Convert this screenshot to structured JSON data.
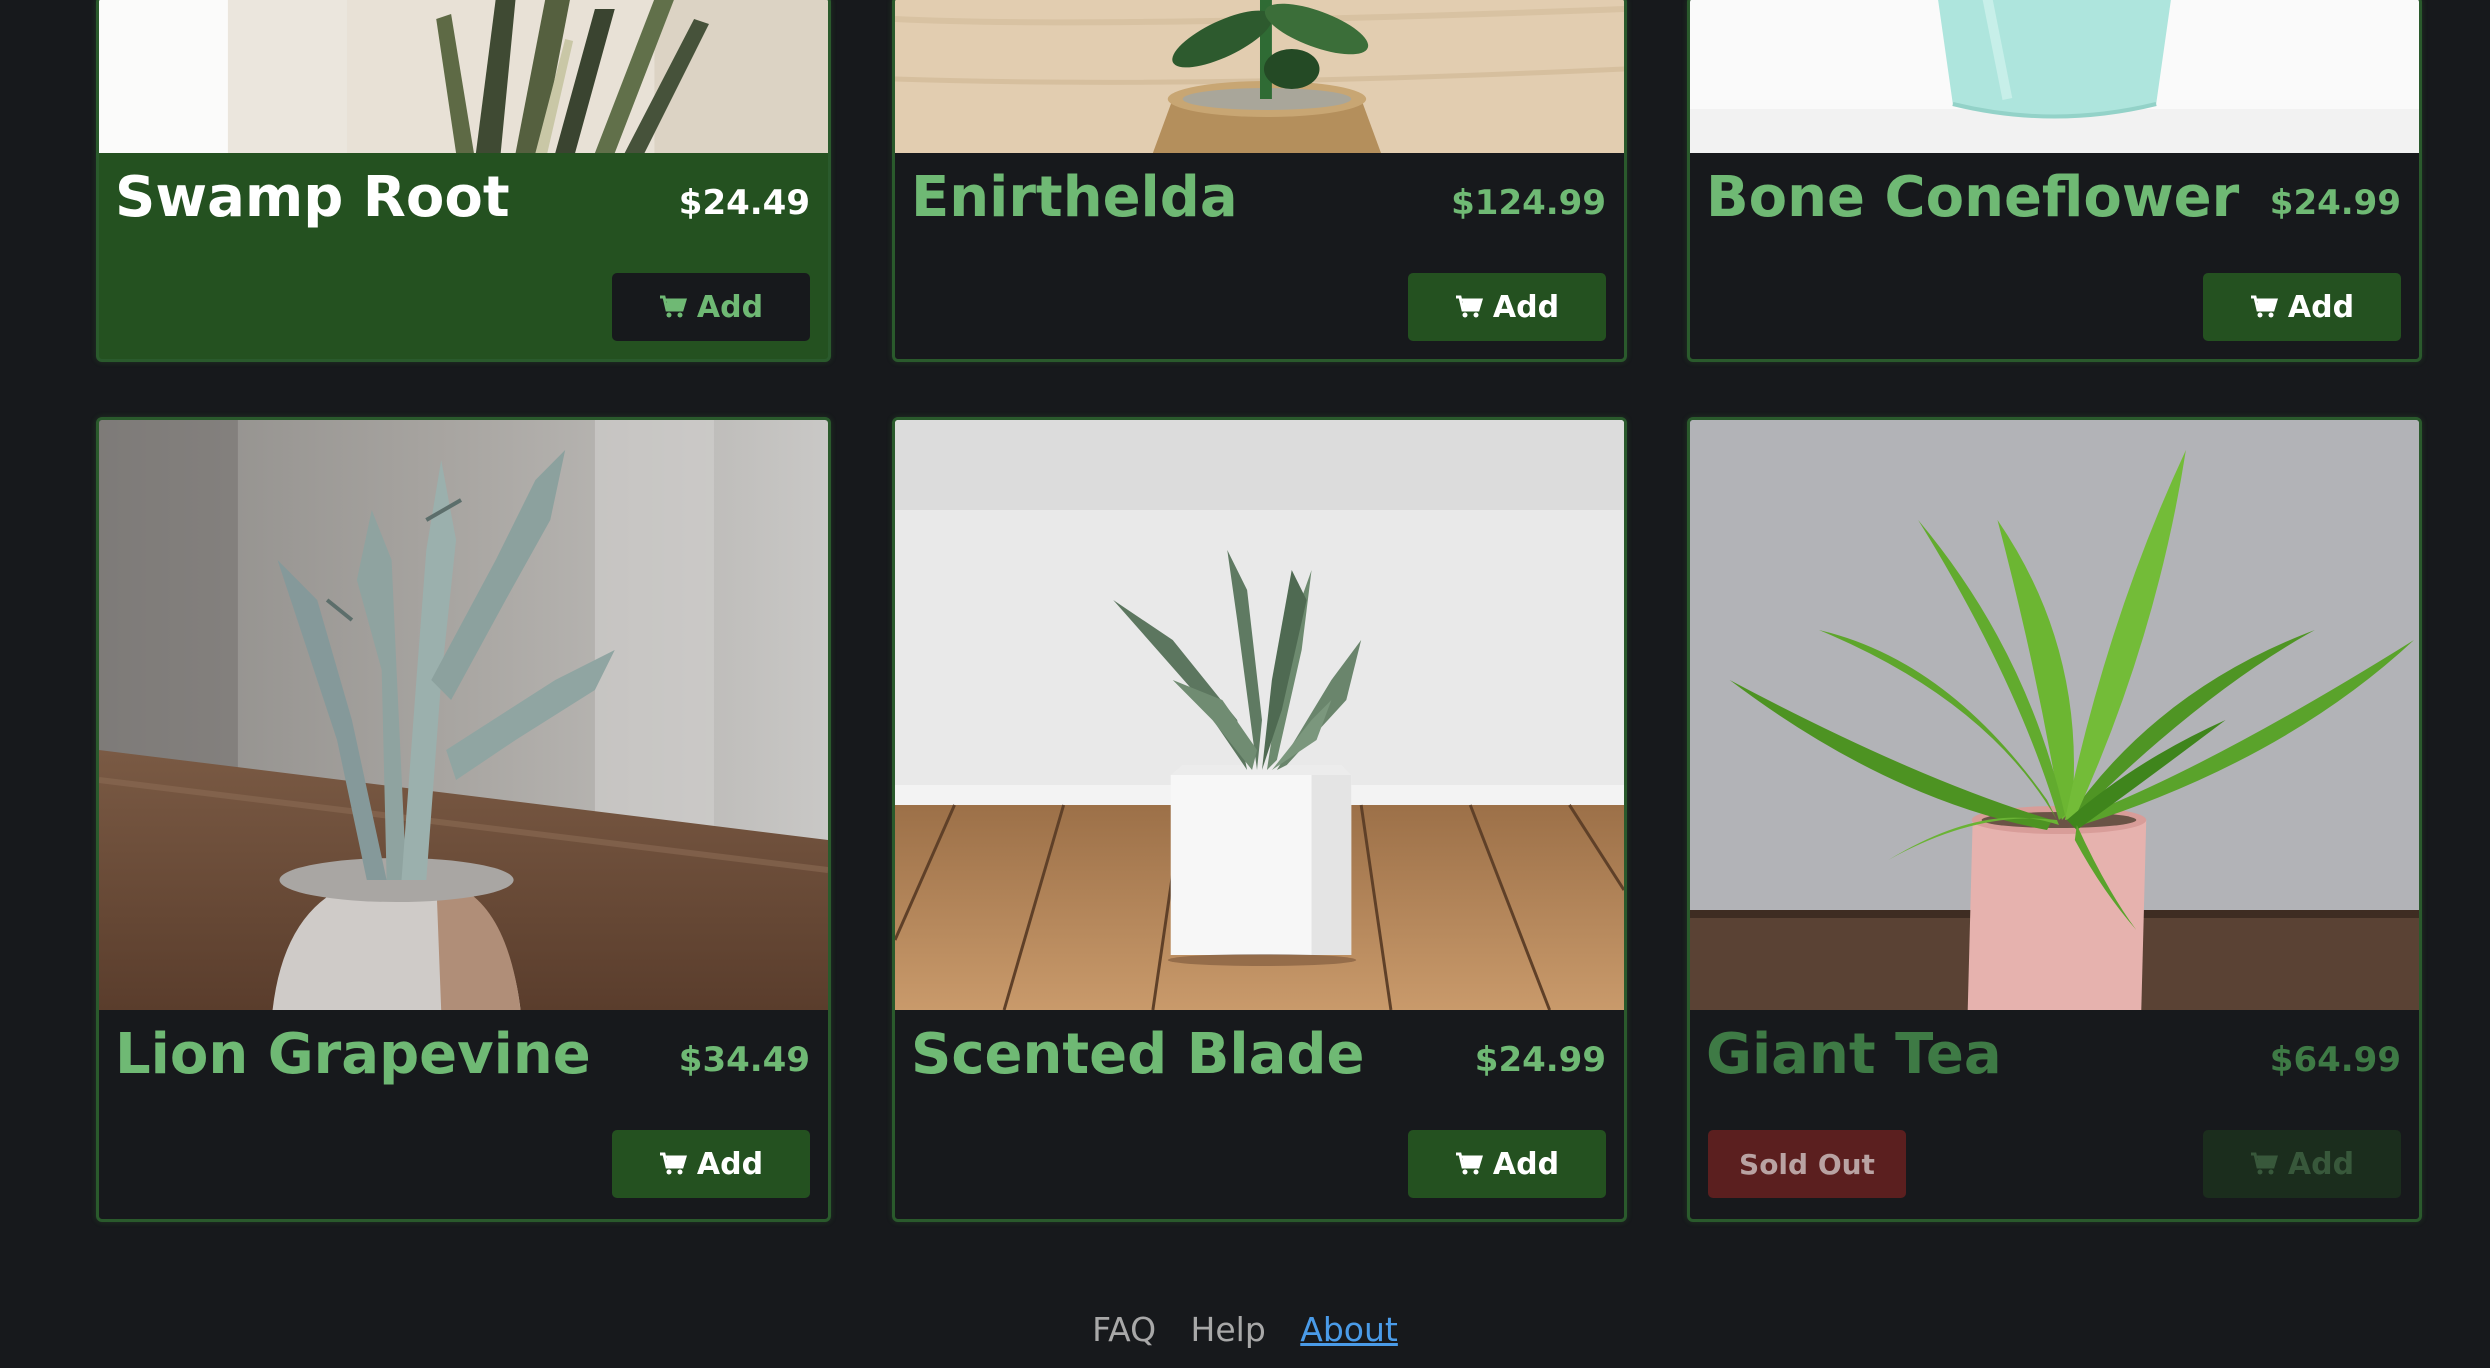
{
  "products": [
    {
      "name": "Swamp Root",
      "price": "$24.49",
      "add_label": "Add"
    },
    {
      "name": "Enirthelda",
      "price": "$124.99",
      "add_label": "Add"
    },
    {
      "name": "Bone Coneflower",
      "price": "$24.99",
      "add_label": "Add"
    },
    {
      "name": "Lion Grapevine",
      "price": "$34.49",
      "add_label": "Add"
    },
    {
      "name": "Scented Blade",
      "price": "$24.99",
      "add_label": "Add"
    },
    {
      "name": "Giant Tea",
      "price": "$64.99",
      "add_label": "Add",
      "sold_out_label": "Sold Out"
    }
  ],
  "footer": {
    "faq": "FAQ",
    "help": "Help",
    "about": "About"
  },
  "colors": {
    "background": "#17191c",
    "accent_green": "#6fb974",
    "button_green": "#245120",
    "card_border": "#2a5a2c",
    "sold_out_red": "#5b1f1f",
    "link_blue": "#4a9be8"
  },
  "icons": [
    "cart-icon"
  ]
}
